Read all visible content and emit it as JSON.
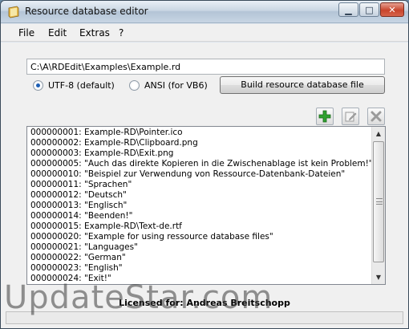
{
  "window": {
    "title": "Resource database editor",
    "controls": {
      "minimize": "▁",
      "maximize": "□",
      "close": "✕"
    }
  },
  "menu": [
    {
      "label": "File"
    },
    {
      "label": "Edit"
    },
    {
      "label": "Extras"
    },
    {
      "label": "?"
    }
  ],
  "path_field": {
    "value": "C:\\A\\RDEdit\\Examples\\Example.rd"
  },
  "encoding": {
    "options": [
      {
        "label": "UTF-8 (default)",
        "checked": true
      },
      {
        "label": "ANSI (for VB6)",
        "checked": false
      }
    ]
  },
  "build_button": {
    "label": "Build resource database file"
  },
  "toolbar": {
    "add_icon": "plus-icon",
    "edit_icon": "edit-icon",
    "delete_icon": "delete-icon"
  },
  "entries": [
    "000000001: Example-RD\\Pointer.ico",
    "000000002: Example-RD\\Clipboard.png",
    "000000003: Example-RD\\Exit.png",
    "000000005: \"Auch das direkte Kopieren in die Zwischenablage ist kein Problem!\"",
    "000000010: \"Beispiel zur Verwendung von Ressource-Datenbank-Dateien\"",
    "000000011: \"Sprachen\"",
    "000000012: \"Deutsch\"",
    "000000013: \"Englisch\"",
    "000000014: \"Beenden!\"",
    "000000015: Example-RD\\Text-de.rtf",
    "000000020: \"Example for using ressource database files\"",
    "000000021: \"Languages\"",
    "000000022: \"German\"",
    "000000023: \"English\"",
    "000000024: \"Exit!\""
  ],
  "license": "Licensed for: Andreas Breitschopp",
  "watermark": "UpdateStar.com",
  "colors": {
    "accent_green": "#2fa12f",
    "radio_selected": "#1d5fb5"
  }
}
